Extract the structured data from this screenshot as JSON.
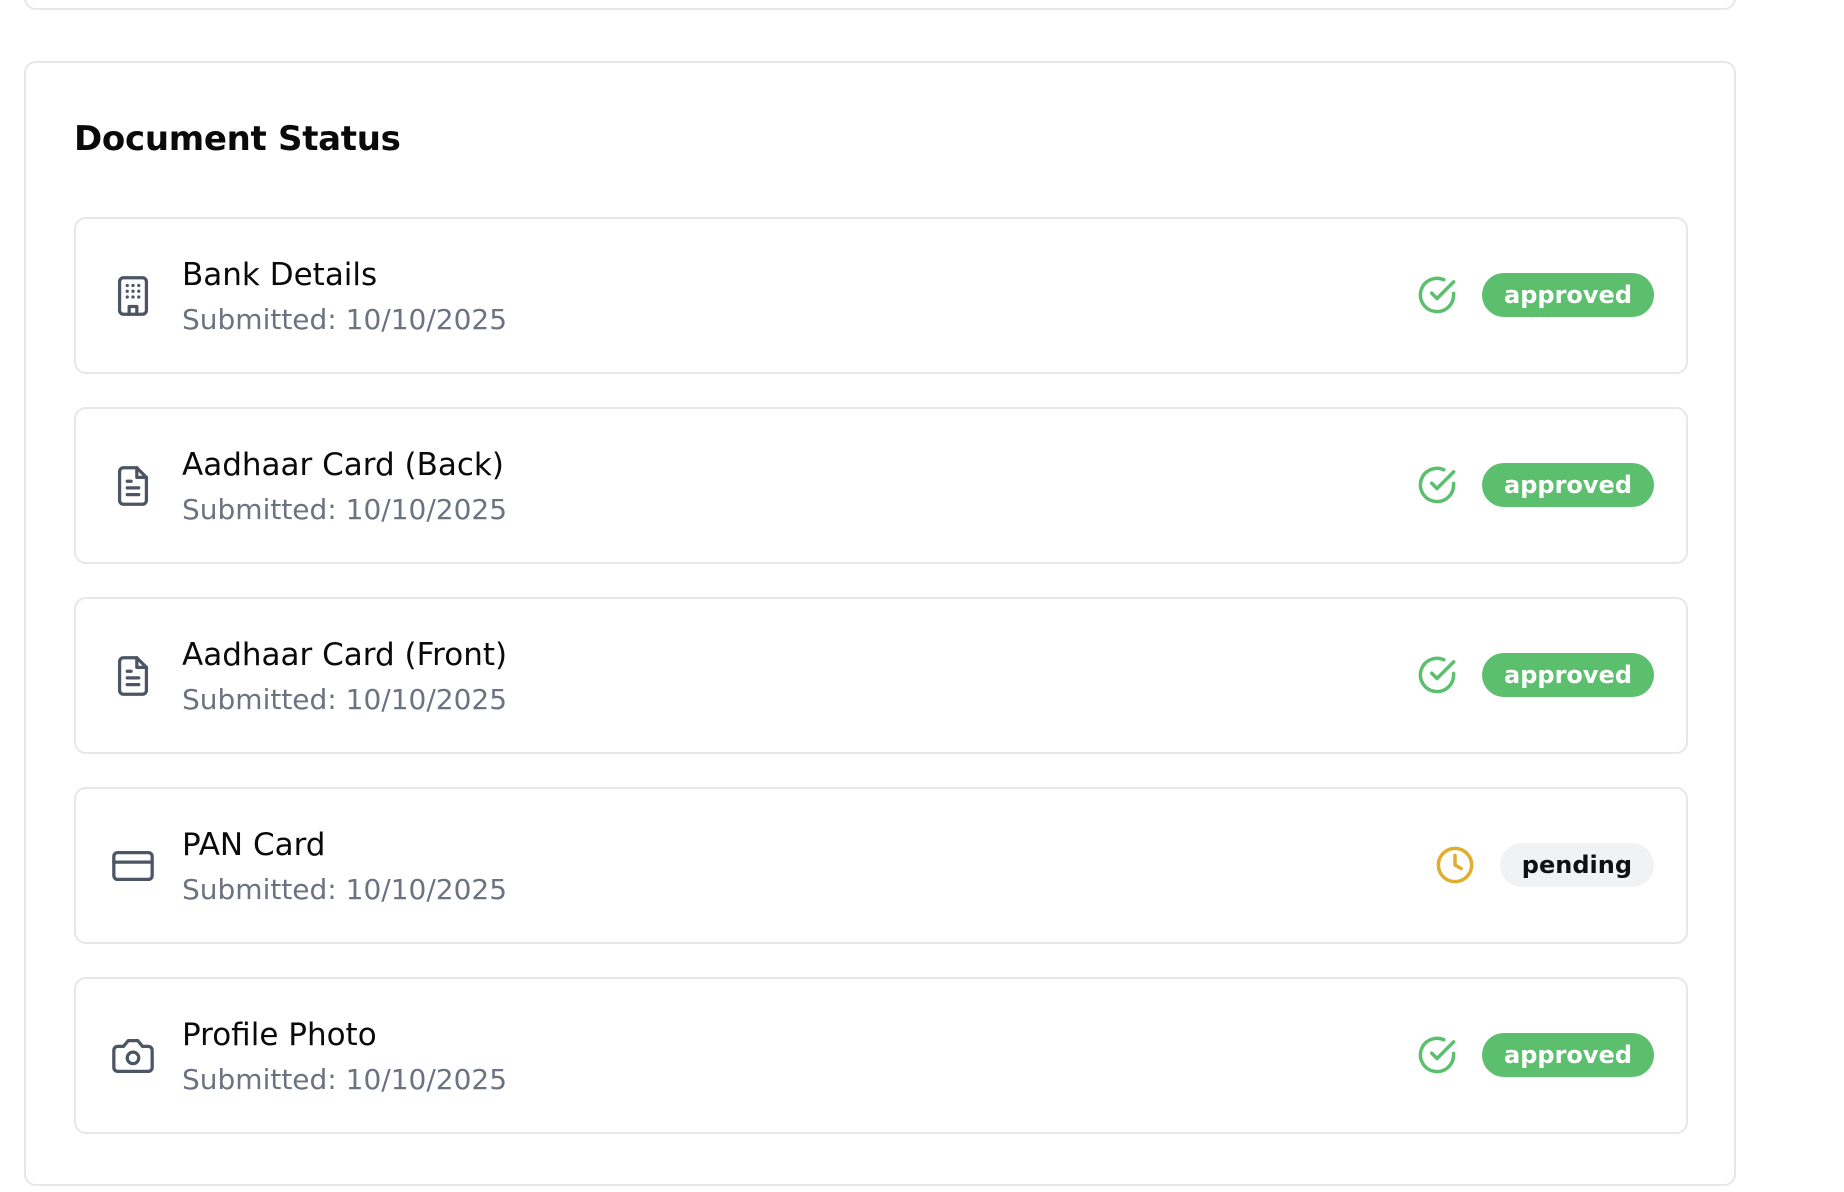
{
  "card": {
    "title": "Document Status"
  },
  "colors": {
    "approved_badge": "#5cbf6e",
    "approved_icon": "#5cbf6e",
    "pending_badge": "#f1f2f4",
    "pending_icon": "#e0ad2e",
    "muted_text": "#6b7280",
    "border": "#e5e7eb"
  },
  "documents": [
    {
      "name": "Bank Details",
      "submitted": "Submitted: 10/10/2025",
      "icon": "building-icon",
      "status": "approved",
      "status_icon": "check-circle-icon"
    },
    {
      "name": "Aadhaar Card (Back)",
      "submitted": "Submitted: 10/10/2025",
      "icon": "file-text-icon",
      "status": "approved",
      "status_icon": "check-circle-icon"
    },
    {
      "name": "Aadhaar Card (Front)",
      "submitted": "Submitted: 10/10/2025",
      "icon": "file-text-icon",
      "status": "approved",
      "status_icon": "check-circle-icon"
    },
    {
      "name": "PAN Card",
      "submitted": "Submitted: 10/10/2025",
      "icon": "credit-card-icon",
      "status": "pending",
      "status_icon": "clock-icon"
    },
    {
      "name": "Profile Photo",
      "submitted": "Submitted: 10/10/2025",
      "icon": "camera-icon",
      "status": "approved",
      "status_icon": "check-circle-icon"
    }
  ]
}
